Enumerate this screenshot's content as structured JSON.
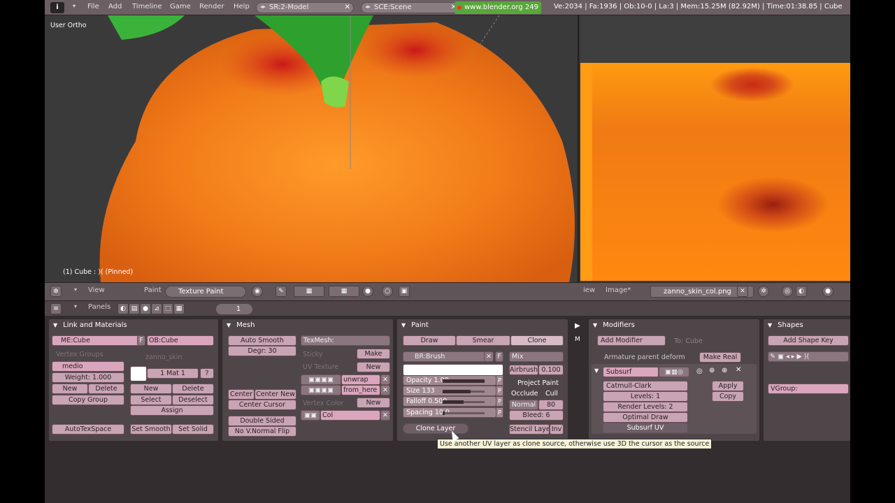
{
  "topbar": {
    "menus": [
      "File",
      "Add",
      "Timeline",
      "Game",
      "Render",
      "Help"
    ],
    "screen": "SR:2-Model",
    "scene": "SCE:Scene",
    "url": "www.blender.org 249",
    "stats": "Ve:2034 | Fa:1936 | Ob:10-0 | La:3  | Mem:15.25M (82.92M) | Time:01:38.85 | Cube"
  },
  "viewport": {
    "label": "User Ortho",
    "status": "(1) Cube : )( (Pinned)",
    "header": {
      "view": "View",
      "paint": "Paint",
      "mode": "Texture Paint"
    }
  },
  "imageview": {
    "header": {
      "view": "iew",
      "image": "Image*",
      "filename": "zanno_skin_col.png"
    }
  },
  "buttons_header": {
    "panels": "Panels",
    "page": "1"
  },
  "link_materials": {
    "title": "Link and Materials",
    "mesh_name": "ME:Cube",
    "f_label": "F",
    "object_name": "OB:Cube",
    "vertex_groups_label": "Vertex Groups",
    "material_label": "zanno_skin",
    "group_name": "medio",
    "weight": "Weight: 1.000",
    "mat_slot": "1 Mat 1",
    "help": "?",
    "new": "New",
    "delete": "Delete",
    "new2": "New",
    "delete2": "Delete",
    "copy_group": "Copy Group",
    "select": "Select",
    "deselect": "Deselect",
    "assign": "Assign",
    "autotexspace": "AutoTexSpace",
    "set_smooth": "Set Smooth",
    "set_solid": "Set Solid"
  },
  "mesh": {
    "title": "Mesh",
    "auto_smooth": "Auto Smooth",
    "degr": "Degr: 30",
    "texmesh": "TexMesh:",
    "sticky": "Sticky",
    "make": "Make",
    "uv_texture": "UV Texture",
    "new_uv": "New",
    "uv1": "unwrap",
    "uv2": "from_here",
    "vertex_color": "Vertex Color",
    "new_vc": "New",
    "vc1": "Col",
    "center": "Center",
    "center_new": "Center New",
    "center_cursor": "Center Cursor",
    "double_sided": "Double Sided",
    "no_vnormal": "No V.Normal Flip"
  },
  "paint": {
    "title": "Paint",
    "tabs": [
      "Draw",
      "Smear",
      "Clone"
    ],
    "brush": "BR:Brush",
    "f": "F",
    "blend": "Mix",
    "airbrush": "Airbrush",
    "airbrush_val": "0.100",
    "opacity": "Opacity 1.00",
    "opacity_frac": 1.0,
    "size": "Size 133",
    "size_frac": 0.66,
    "falloff": "Falloff 0.500",
    "falloff_frac": 0.5,
    "spacing": "Spacing 10.0",
    "spacing_frac": 0.05,
    "p": "P",
    "project_paint": "Project Paint",
    "occlude": "Occlude",
    "cull": "Cull",
    "normal": "Normal",
    "normal_val": "80",
    "bleed": "Bleed: 6",
    "clone_layer": "Clone Layer",
    "stencil_layer": "Stencil Laye",
    "inv": "Inv",
    "tooltip": "Use another UV layer as clone source, otherwise use 3D the cursor as the source"
  },
  "modifiers": {
    "title": "Modifiers",
    "add_modifier": "Add Modifier",
    "to": "To: Cube",
    "armature": "Armature parent deform",
    "make_real": "Make Real",
    "subsurf_name": "Subsurf",
    "type": "Catmull-Clark",
    "levels": "Levels: 1",
    "render_levels": "Render Levels: 2",
    "optimal_draw": "Optimal Draw",
    "subsurf_uv": "Subsurf UV",
    "apply": "Apply",
    "copy": "Copy"
  },
  "shapes": {
    "title": "Shapes",
    "add_shape_key": "Add Shape Key",
    "vgroup": "VGroup:"
  },
  "colors": {
    "accent": "#d9a6bd",
    "bg": "#3a3436",
    "orange": "#f07a14"
  }
}
